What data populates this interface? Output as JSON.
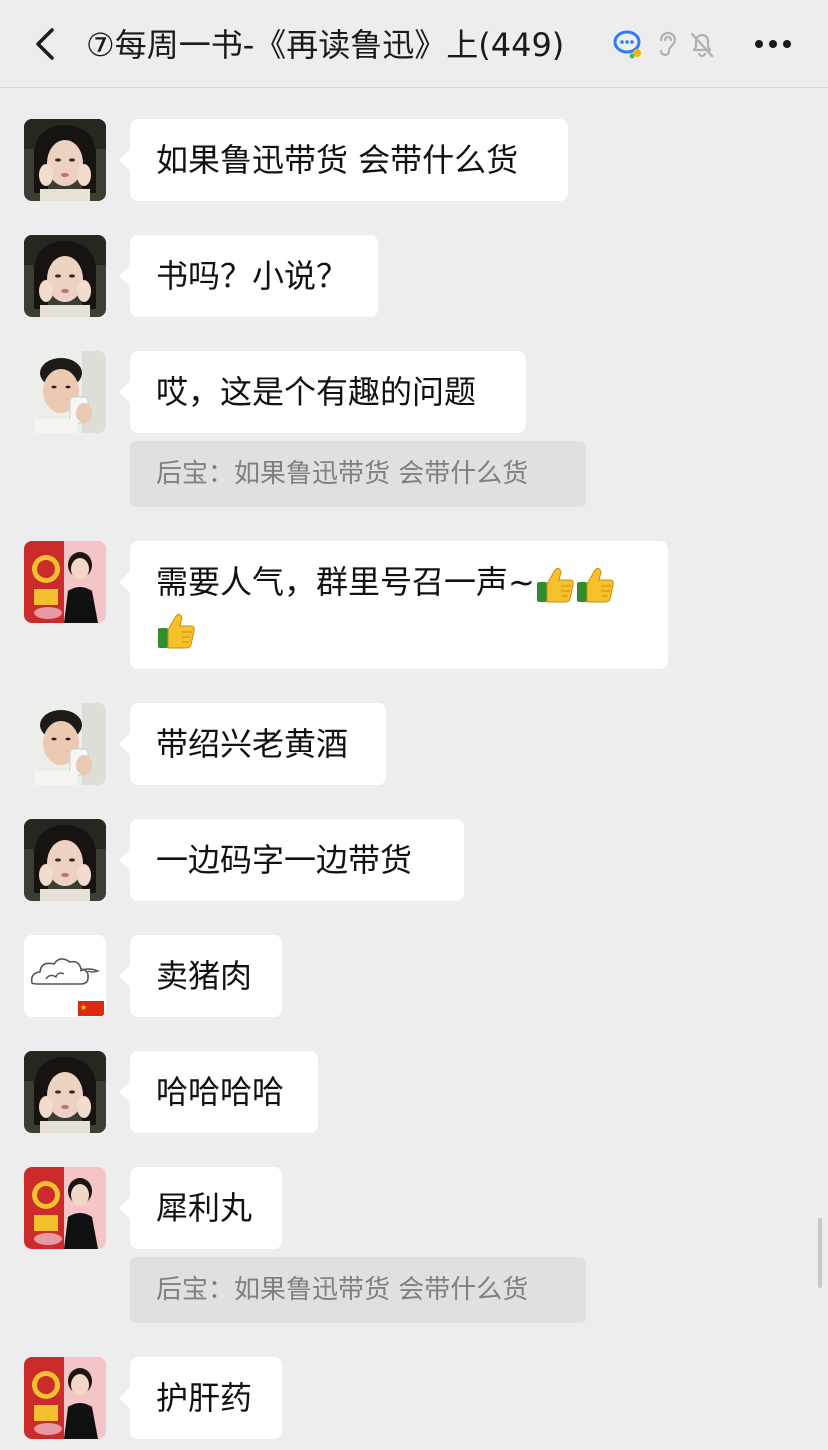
{
  "header": {
    "title": "⑦每周一书-《再读鲁迅》上(449)",
    "back_icon": "chevron-left-icon",
    "chat_icon": "group-chat-icon",
    "ear_icon": "earpiece-icon",
    "mute_icon": "bell-off-icon",
    "more_icon": "more-dots-icon"
  },
  "messages": [
    {
      "avatar": "avatar-woman-dark-hair",
      "text": "如果鲁迅带货 会带什么货"
    },
    {
      "avatar": "avatar-woman-dark-hair",
      "text": "书吗？小说？"
    },
    {
      "avatar": "avatar-man-drinking",
      "text": "哎，这是个有趣的问题",
      "quote": "后宝：如果鲁迅带货 会带什么货"
    },
    {
      "avatar": "avatar-woman-red-poster",
      "text_line1": "需要人气，群里号召一声~",
      "emoji": "thumbs-up-icon"
    },
    {
      "avatar": "avatar-man-drinking",
      "text": "带绍兴老黄酒"
    },
    {
      "avatar": "avatar-woman-dark-hair",
      "text": "一边码字一边带货"
    },
    {
      "avatar": "avatar-cloud-flag",
      "text": "卖猪肉"
    },
    {
      "avatar": "avatar-woman-dark-hair",
      "text": "哈哈哈哈"
    },
    {
      "avatar": "avatar-woman-red-poster",
      "text": "犀利丸",
      "quote": "后宝：如果鲁迅带货 会带什么货"
    },
    {
      "avatar": "avatar-woman-red-poster",
      "text": "护肝药"
    }
  ],
  "colors": {
    "background": "#ededed",
    "bubble": "#ffffff",
    "quote_bg": "#e0e0e0",
    "quote_text": "#808080",
    "accent": "#2e7cf6"
  }
}
